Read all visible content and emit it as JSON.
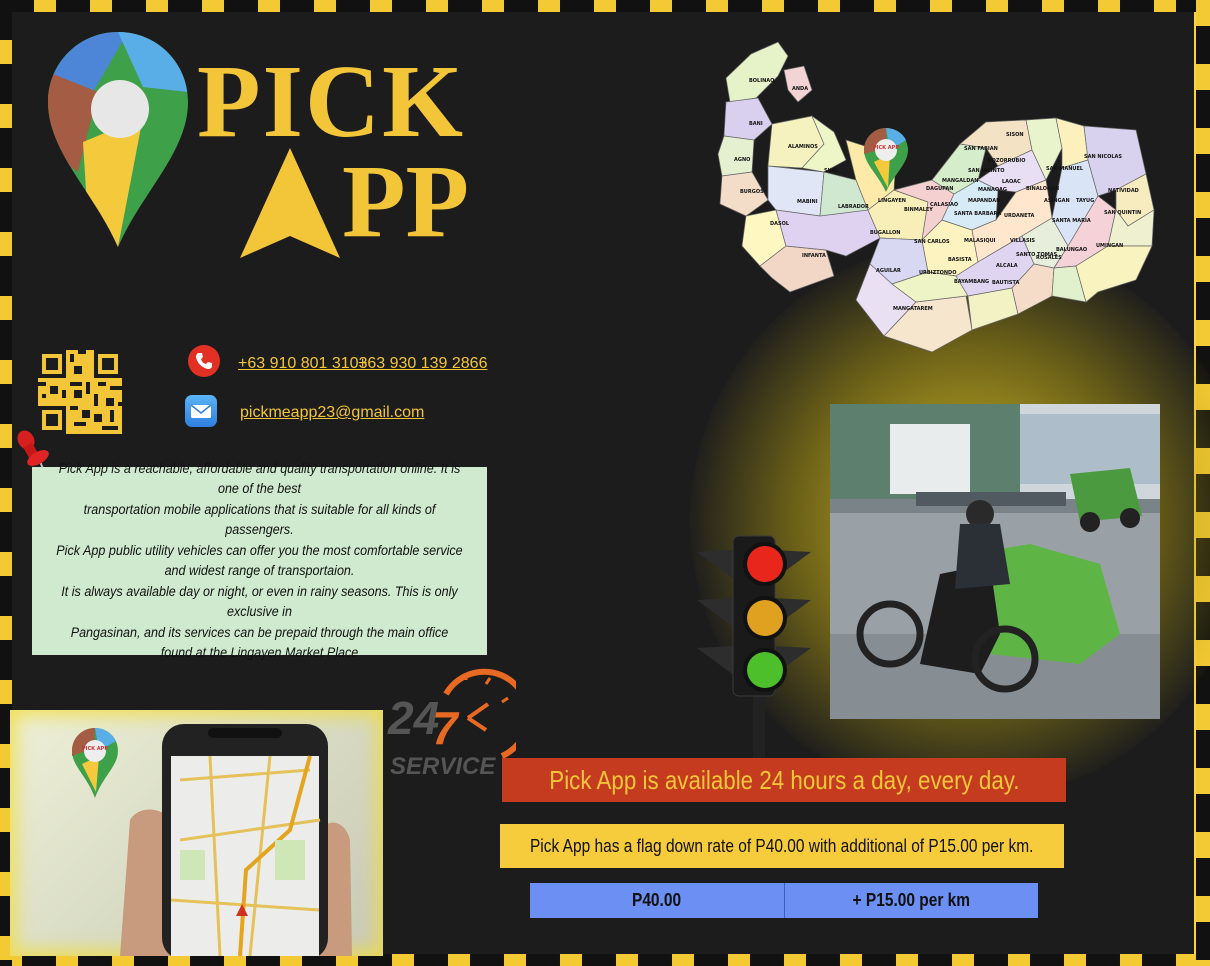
{
  "brand": {
    "line1": "PICK",
    "line2_rest": "PP",
    "pin_label": "PICK APP"
  },
  "colors": {
    "accent_yellow": "#f3c63a",
    "background_dark": "#1c1c1c",
    "banner_red": "#c53b1f",
    "rate_blue": "#6b8ff2",
    "desc_green": "#cfeacf"
  },
  "map": {
    "towns": [
      "BOLINAO",
      "ANDA",
      "BANI",
      "AGNO",
      "ALAMINOS",
      "SUAL",
      "BURGOS",
      "MABINI",
      "LABRADOR",
      "LINGAYEN",
      "DASOL",
      "INFANTA",
      "BINMALEY",
      "BUGALLON",
      "CALASIAO",
      "DAGUPAN",
      "MANGALDAN",
      "SAN FABIAN",
      "SAN JACINTO",
      "SISON",
      "POZORRUBIO",
      "LAOAC",
      "MANAOAG",
      "BINALONAN",
      "SAN MANUEL",
      "SAN NICOLAS",
      "MAPANDAN",
      "SANTA BARBARA",
      "URDANETA",
      "ASINGAN",
      "TAYUG",
      "NATIVIDAD",
      "SAN QUINTIN",
      "SANTA MARIA",
      "SAN CARLOS",
      "MALASIQUI",
      "VILLASIS",
      "BALUNGAO",
      "UMINGAN",
      "AGUILAR",
      "URBIZTONDO",
      "BASISTA",
      "ALCALA",
      "SANTO TOMAS",
      "ROSALES",
      "BAYAMBANG",
      "BAUTISTA",
      "MANGATAREM"
    ]
  },
  "contact": {
    "phone1": "+63 910 801 3103",
    "phone2": "+63 930 139 2866",
    "email": "pickmeapp23@gmail.com"
  },
  "description": "Pick App is a reachable, affordable and quality transportation online.  It is one of the best\ntransportation mobile applications that is suitable for all kinds of passengers.\nPick App public utility vehicles can offer you the most comfortable service\nand widest range of transportaion.\nIt is always available day or night, or even in rainy seasons. This is only exclusive in\nPangasinan, and its services can be prepaid through the main office\nfound at the Lingayen Market Place",
  "service_badge": {
    "number_left": "24",
    "number_right": "7",
    "label": "SERVICE"
  },
  "banners": {
    "availability": "Pick App is available 24 hours a day, every day.",
    "rate": "Pick App has a flag down rate of P40.00 with additional of P15.00 per km."
  },
  "rates": {
    "flag_down": "P40.00",
    "per_km": "+ P15.00 per km"
  },
  "icons": [
    "map-pin-icon",
    "phone-icon",
    "mail-icon",
    "qr-code-icon",
    "pushpin-icon",
    "traffic-light-icon",
    "clock-icon"
  ]
}
